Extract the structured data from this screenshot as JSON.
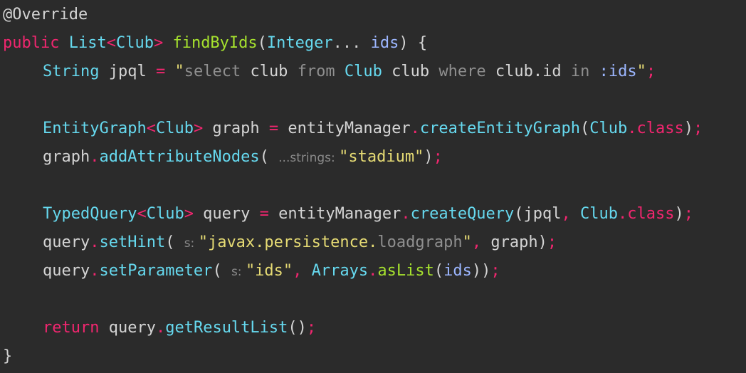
{
  "code": {
    "lines": [
      {
        "tokens": [
          {
            "text": "@Override",
            "color": "#d4d4d4"
          }
        ]
      },
      {
        "tokens": [
          {
            "text": "public",
            "color": "#f1266f"
          },
          {
            "text": " ",
            "color": "#d4d4d4"
          },
          {
            "text": "List",
            "color": "#66d9ef"
          },
          {
            "text": "<",
            "color": "#f1266f"
          },
          {
            "text": "Club",
            "color": "#66d9ef"
          },
          {
            "text": ">",
            "color": "#f1266f"
          },
          {
            "text": " ",
            "color": "#d4d4d4"
          },
          {
            "text": "findByIds",
            "color": "#a6e22e"
          },
          {
            "text": "(",
            "color": "#d4d4d4"
          },
          {
            "text": "Integer",
            "color": "#66d9ef"
          },
          {
            "text": "...",
            "color": "#d4d4d4"
          },
          {
            "text": " ",
            "color": "#d4d4d4"
          },
          {
            "text": "ids",
            "color": "#9cb6ff"
          },
          {
            "text": ") {",
            "color": "#d4d4d4"
          }
        ]
      },
      {
        "tokens": [
          {
            "text": "String",
            "color": "#66d9ef"
          },
          {
            "text": " jpql ",
            "color": "#d4d4d4"
          },
          {
            "text": "=",
            "color": "#f1266f"
          },
          {
            "text": " ",
            "color": "#d4d4d4"
          },
          {
            "text": "\"",
            "color": "#e6db74"
          },
          {
            "text": "select",
            "color": "#8f8f8f"
          },
          {
            "text": " club ",
            "color": "#d4d4d4"
          },
          {
            "text": "from",
            "color": "#8f8f8f"
          },
          {
            "text": " ",
            "color": "#d4d4d4"
          },
          {
            "text": "Club",
            "color": "#66d9ef"
          },
          {
            "text": " club ",
            "color": "#d4d4d4"
          },
          {
            "text": "where",
            "color": "#8f8f8f"
          },
          {
            "text": " club.id ",
            "color": "#d4d4d4"
          },
          {
            "text": "in",
            "color": "#8f8f8f"
          },
          {
            "text": " ",
            "color": "#d4d4d4"
          },
          {
            "text": ":ids",
            "color": "#9cb6ff"
          },
          {
            "text": "\"",
            "color": "#e6db74"
          },
          {
            "text": ";",
            "color": "#f1266f"
          }
        ]
      },
      {
        "tokens": []
      },
      {
        "tokens": [
          {
            "text": "EntityGraph",
            "color": "#66d9ef"
          },
          {
            "text": "<",
            "color": "#f1266f"
          },
          {
            "text": "Club",
            "color": "#66d9ef"
          },
          {
            "text": ">",
            "color": "#f1266f"
          },
          {
            "text": " graph ",
            "color": "#d4d4d4"
          },
          {
            "text": "=",
            "color": "#f1266f"
          },
          {
            "text": " entityManager",
            "color": "#d4d4d4"
          },
          {
            "text": ".",
            "color": "#f1266f"
          },
          {
            "text": "createEntityGraph",
            "color": "#66d9ef"
          },
          {
            "text": "(",
            "color": "#d4d4d4"
          },
          {
            "text": "Club",
            "color": "#66d9ef"
          },
          {
            "text": ".",
            "color": "#f1266f"
          },
          {
            "text": "class",
            "color": "#f1266f"
          },
          {
            "text": ")",
            "color": "#d4d4d4"
          },
          {
            "text": ";",
            "color": "#f1266f"
          }
        ]
      },
      {
        "tokens": [
          {
            "text": "graph",
            "color": "#d4d4d4"
          },
          {
            "text": ".",
            "color": "#f1266f"
          },
          {
            "text": "addAttributeNodes",
            "color": "#66d9ef"
          },
          {
            "text": "( ",
            "color": "#d4d4d4"
          },
          {
            "text": "...strings: ",
            "color": "#8a8a8a",
            "hint": true
          },
          {
            "text": "\"stadium\"",
            "color": "#e6db74"
          },
          {
            "text": ")",
            "color": "#d4d4d4"
          },
          {
            "text": ";",
            "color": "#f1266f"
          }
        ]
      },
      {
        "tokens": []
      },
      {
        "tokens": [
          {
            "text": "TypedQuery",
            "color": "#66d9ef"
          },
          {
            "text": "<",
            "color": "#f1266f"
          },
          {
            "text": "Club",
            "color": "#66d9ef"
          },
          {
            "text": ">",
            "color": "#f1266f"
          },
          {
            "text": " query ",
            "color": "#d4d4d4"
          },
          {
            "text": "=",
            "color": "#f1266f"
          },
          {
            "text": " entityManager",
            "color": "#d4d4d4"
          },
          {
            "text": ".",
            "color": "#f1266f"
          },
          {
            "text": "createQuery",
            "color": "#66d9ef"
          },
          {
            "text": "(jpql",
            "color": "#d4d4d4"
          },
          {
            "text": ",",
            "color": "#f1266f"
          },
          {
            "text": " ",
            "color": "#d4d4d4"
          },
          {
            "text": "Club",
            "color": "#66d9ef"
          },
          {
            "text": ".",
            "color": "#f1266f"
          },
          {
            "text": "class",
            "color": "#f1266f"
          },
          {
            "text": ")",
            "color": "#d4d4d4"
          },
          {
            "text": ";",
            "color": "#f1266f"
          }
        ]
      },
      {
        "tokens": [
          {
            "text": "query",
            "color": "#d4d4d4"
          },
          {
            "text": ".",
            "color": "#f1266f"
          },
          {
            "text": "setHint",
            "color": "#66d9ef"
          },
          {
            "text": "( ",
            "color": "#d4d4d4"
          },
          {
            "text": "s: ",
            "color": "#8a8a8a",
            "hint": true
          },
          {
            "text": "\"javax.persistence.",
            "color": "#e6db74"
          },
          {
            "text": "loadgraph",
            "color": "#8f8f8f"
          },
          {
            "text": "\"",
            "color": "#e6db74"
          },
          {
            "text": ",",
            "color": "#f1266f"
          },
          {
            "text": " graph)",
            "color": "#d4d4d4"
          },
          {
            "text": ";",
            "color": "#f1266f"
          }
        ]
      },
      {
        "tokens": [
          {
            "text": "query",
            "color": "#d4d4d4"
          },
          {
            "text": ".",
            "color": "#f1266f"
          },
          {
            "text": "setParameter",
            "color": "#66d9ef"
          },
          {
            "text": "( ",
            "color": "#d4d4d4"
          },
          {
            "text": "s: ",
            "color": "#8a8a8a",
            "hint": true
          },
          {
            "text": "\"ids\"",
            "color": "#e6db74"
          },
          {
            "text": ",",
            "color": "#f1266f"
          },
          {
            "text": " ",
            "color": "#d4d4d4"
          },
          {
            "text": "Arrays",
            "color": "#66d9ef"
          },
          {
            "text": ".",
            "color": "#f1266f"
          },
          {
            "text": "asList",
            "color": "#a6e22e"
          },
          {
            "text": "(",
            "color": "#d4d4d4"
          },
          {
            "text": "ids",
            "color": "#9cb6ff"
          },
          {
            "text": "))",
            "color": "#d4d4d4"
          },
          {
            "text": ";",
            "color": "#f1266f"
          }
        ]
      },
      {
        "tokens": []
      },
      {
        "tokens": [
          {
            "text": "return",
            "color": "#f1266f"
          },
          {
            "text": " query",
            "color": "#d4d4d4"
          },
          {
            "text": ".",
            "color": "#f1266f"
          },
          {
            "text": "getResultList",
            "color": "#66d9ef"
          },
          {
            "text": "()",
            "color": "#d4d4d4"
          },
          {
            "text": ";",
            "color": "#f1266f"
          }
        ]
      },
      {
        "tokens": [
          {
            "text": "}",
            "color": "#d4d4d4"
          }
        ]
      }
    ]
  }
}
